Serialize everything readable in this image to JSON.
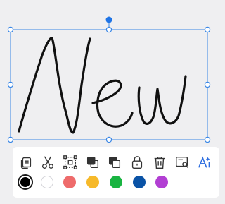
{
  "canvas": {
    "handwriting_text": "New",
    "ink_color": "#111111",
    "selection_color": "#3b87e5"
  },
  "toolbar": {
    "tools": [
      {
        "name": "copy-icon",
        "label": ""
      },
      {
        "name": "scissors-icon",
        "label": ""
      },
      {
        "name": "select-area-icon",
        "label": ""
      },
      {
        "name": "bring-forward-icon",
        "label": ""
      },
      {
        "name": "send-backward-icon",
        "label": ""
      },
      {
        "name": "lock-icon",
        "label": ""
      },
      {
        "name": "trash-icon",
        "label": ""
      },
      {
        "name": "search-text-icon",
        "label": ""
      },
      {
        "name": "ai-text-icon",
        "label": ""
      }
    ],
    "colors": [
      {
        "name": "black",
        "hex": "#000000",
        "selected": true
      },
      {
        "name": "white",
        "hex": "#ffffff",
        "selected": false
      },
      {
        "name": "red",
        "hex": "#ee6b6b",
        "selected": false
      },
      {
        "name": "yellow",
        "hex": "#f6b92a",
        "selected": false
      },
      {
        "name": "green",
        "hex": "#19b441",
        "selected": false
      },
      {
        "name": "blue",
        "hex": "#0a53a6",
        "selected": false
      },
      {
        "name": "purple",
        "hex": "#b23fd3",
        "selected": false
      }
    ]
  }
}
